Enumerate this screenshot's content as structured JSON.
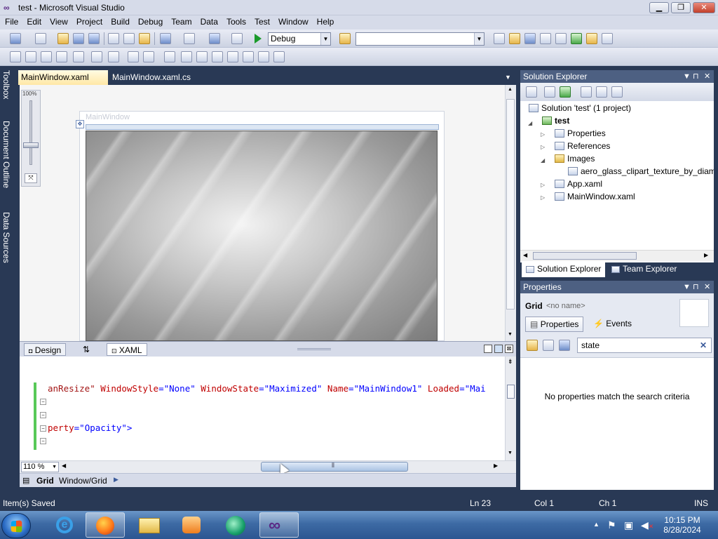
{
  "window": {
    "title": "test - Microsoft Visual Studio",
    "minimize": "▁",
    "maximize": "❐",
    "close": "✕"
  },
  "menu": [
    "File",
    "Edit",
    "View",
    "Project",
    "Build",
    "Debug",
    "Team",
    "Data",
    "Tools",
    "Test",
    "Window",
    "Help"
  ],
  "toolbar": {
    "config_value": "Debug",
    "platform_value": ""
  },
  "left_tabs": [
    "Toolbox",
    "Document Outline",
    "Data Sources"
  ],
  "doc_tabs": [
    {
      "label": "MainWindow.xaml",
      "active": true,
      "close": "✕"
    },
    {
      "label": "MainWindow.xaml.cs",
      "active": false
    }
  ],
  "designer": {
    "zoom": "100%",
    "window_caption": "MainWindow"
  },
  "split_tabs": {
    "design": "Design",
    "swap": "⇅",
    "xaml": "XAML"
  },
  "code_lines": [
    {
      "parts": [
        {
          "t": "anResize\" ",
          "c": "m"
        },
        {
          "t": "WindowStyle",
          "c": "r"
        },
        {
          "t": "=\"None\" ",
          "c": "b"
        },
        {
          "t": "WindowState",
          "c": "r"
        },
        {
          "t": "=\"Maximized\" ",
          "c": "b"
        },
        {
          "t": "Name",
          "c": "r"
        },
        {
          "t": "=\"MainWindow1\" ",
          "c": "b"
        },
        {
          "t": "Loaded",
          "c": "r"
        },
        {
          "t": "=\"Mai",
          "c": "b"
        }
      ]
    },
    {
      "parts": [
        {
          "t": "perty",
          "c": "r"
        },
        {
          "t": "=\"Opacity\">",
          "c": "b"
        }
      ]
    }
  ],
  "editor": {
    "zoom": "110 %"
  },
  "path_bar": {
    "element": "Grid",
    "path": "Window/Grid"
  },
  "solution_explorer": {
    "title": "Solution Explorer",
    "tree": [
      {
        "label": "Solution 'test' (1 project)",
        "level": 0,
        "icon": "solution-icon"
      },
      {
        "label": "test",
        "level": 1,
        "icon": "project-icon",
        "bold": true,
        "expand": "◢"
      },
      {
        "label": "Properties",
        "level": 2,
        "icon": "properties-icon",
        "expand": "▷"
      },
      {
        "label": "References",
        "level": 2,
        "icon": "references-icon",
        "expand": "▷"
      },
      {
        "label": "Images",
        "level": 2,
        "icon": "folder-icon",
        "expand": "◢"
      },
      {
        "label": "aero_glass_clipart_texture_by_diamo",
        "level": 3,
        "icon": "image-file-icon"
      },
      {
        "label": "App.xaml",
        "level": 2,
        "icon": "xaml-file-icon",
        "expand": "▷"
      },
      {
        "label": "MainWindow.xaml",
        "level": 2,
        "icon": "xaml-file-icon",
        "expand": "▷"
      }
    ],
    "tabs": [
      "Solution Explorer",
      "Team Explorer"
    ]
  },
  "properties": {
    "title": "Properties",
    "element_type": "Grid",
    "element_name": "<no name>",
    "tab_properties": "Properties",
    "tab_events": "Events",
    "search_value": "state",
    "empty_message": "No properties match the search criteria"
  },
  "status": {
    "message": "Item(s) Saved",
    "ln": "Ln 23",
    "col": "Col 1",
    "ch": "Ch 1",
    "mode": "INS"
  },
  "taskbar": {
    "time": "10:15 PM",
    "date": "8/28/2024"
  },
  "colors": {
    "title_bar": "#d6dbe9",
    "frame": "#293955",
    "active_tab": "#ffe8a6",
    "status_bar": "#293955"
  }
}
